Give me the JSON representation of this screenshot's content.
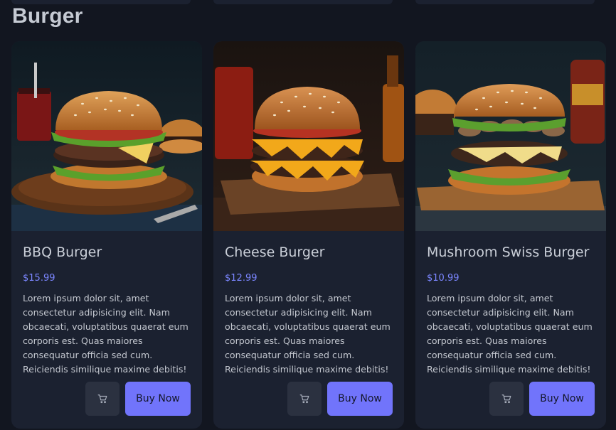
{
  "section": {
    "title": "Burger"
  },
  "products": [
    {
      "name": "BBQ Burger",
      "price": "$15.99",
      "description": "Lorem ipsum dolor sit, amet consectetur adipisicing elit. Nam obcaecati, voluptatibus quaerat eum corporis est. Quas maiores consequatur officia sed cum. Reiciendis similique maxime debitis!",
      "buy_label": "Buy Now",
      "cart_icon": "cart-icon"
    },
    {
      "name": "Cheese Burger",
      "price": "$12.99",
      "description": "Lorem ipsum dolor sit, amet consectetur adipisicing elit. Nam obcaecati, voluptatibus quaerat eum corporis est. Quas maiores consequatur officia sed cum. Reiciendis similique maxime debitis!",
      "buy_label": "Buy Now",
      "cart_icon": "cart-icon"
    },
    {
      "name": "Mushroom Swiss Burger",
      "price": "$10.99",
      "description": "Lorem ipsum dolor sit, amet consectetur adipisicing elit. Nam obcaecati, voluptatibus quaerat eum corporis est. Quas maiores consequatur officia sed cum. Reiciendis similique maxime debitis!",
      "buy_label": "Buy Now",
      "cart_icon": "cart-icon"
    }
  ],
  "colors": {
    "background": "#121620",
    "card": "#1b2130",
    "accent": "#7174fb",
    "price": "#7b86ff",
    "cart_button": "#2b3140"
  }
}
